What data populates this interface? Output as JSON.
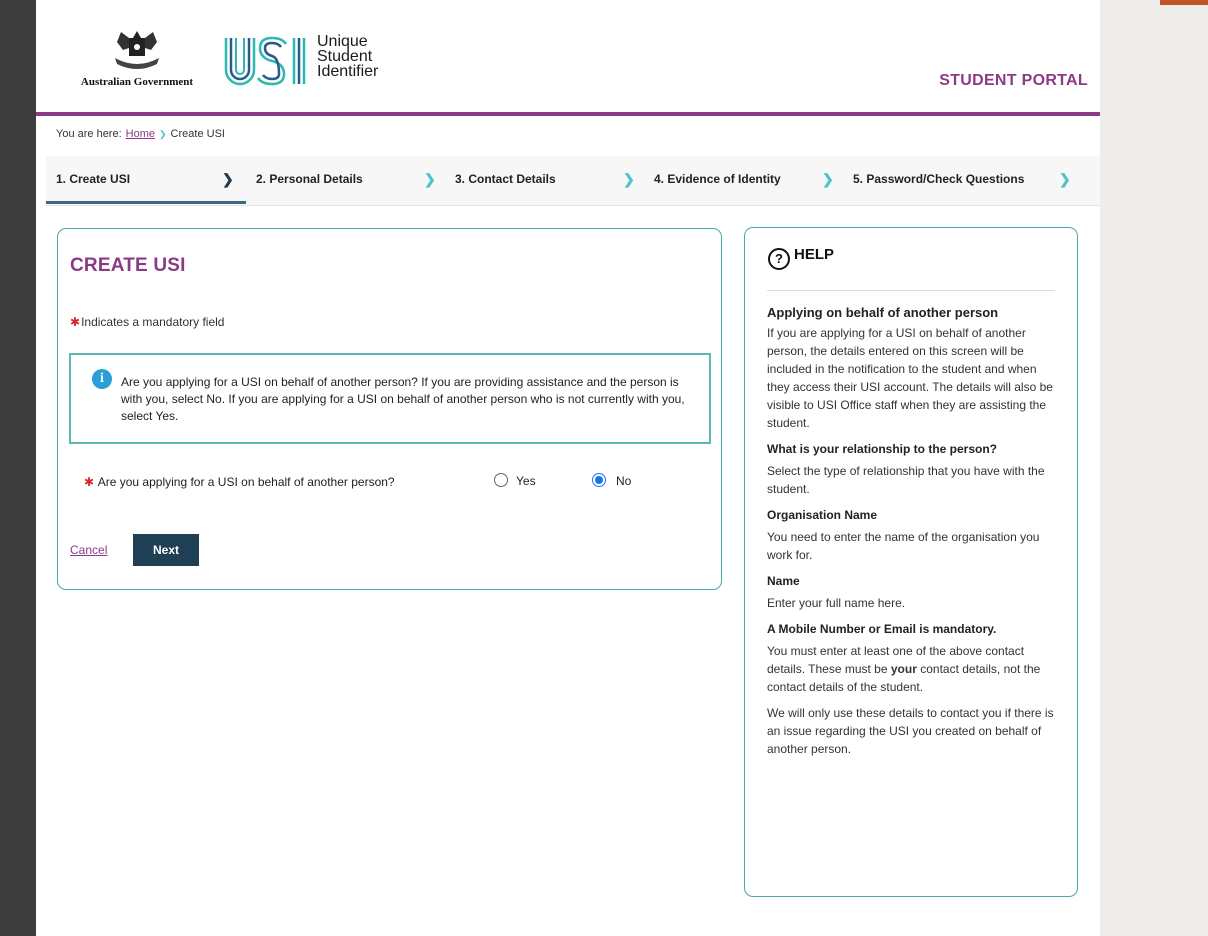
{
  "header": {
    "gov_text": "Australian Government",
    "usi_line1": "Unique",
    "usi_line2": "Student",
    "usi_line3": "Identifier",
    "portal_title": "STUDENT PORTAL"
  },
  "breadcrumb": {
    "prefix": "You are here:",
    "home": "Home",
    "current": "Create USI"
  },
  "steps": [
    {
      "label": "1. Create USI",
      "active": true
    },
    {
      "label": "2. Personal Details",
      "active": false
    },
    {
      "label": "3. Contact Details",
      "active": false
    },
    {
      "label": "4. Evidence of Identity",
      "active": false
    },
    {
      "label": "5. Password/Check Questions",
      "active": false
    }
  ],
  "main": {
    "title": "CREATE USI",
    "mandatory_note": "Indicates a mandatory field",
    "info_text": "Are you applying for a USI on behalf of another person? If you are providing assistance and the person is with you, select No. If you are applying for a USI on behalf of another person who is not currently with you, select Yes.",
    "question": "Are you applying for a USI on behalf of another person?",
    "options": [
      {
        "label": "Yes",
        "selected": false
      },
      {
        "label": "No",
        "selected": true
      }
    ],
    "cancel_label": "Cancel",
    "next_label": "Next"
  },
  "help": {
    "title": "HELP",
    "section_title": "Applying on behalf of another person",
    "intro": "If you are applying for a USI on behalf of another person, the details entered on this screen will be included in the notification to the student and when they access their USI account. The details will also be visible to USI Office staff when they are assisting the student.",
    "relationship_heading": "What is your relationship to the person?",
    "relationship_text": "Select the type of relationship that you have with the student.",
    "org_heading": "Organisation Name",
    "org_text": "You need to enter the name of the organisation you work for.",
    "name_heading": "Name",
    "name_text": "Enter your full name here.",
    "contact_heading": "A Mobile Number or Email is mandatory.",
    "contact_text_1": "You must enter at least one of the above contact details. These must be",
    "contact_text_bold": "your",
    "contact_text_2": "contact details, not the contact details of the student.",
    "final_text": "We will only use these details to contact you if there is an issue regarding the USI you created on behalf of another person."
  },
  "colors": {
    "brand_purple": "#8b3a86",
    "teal": "#4aa8a8",
    "button_navy": "#1f3f55",
    "required_red": "#d9262c",
    "info_blue": "#2a9fd8"
  }
}
